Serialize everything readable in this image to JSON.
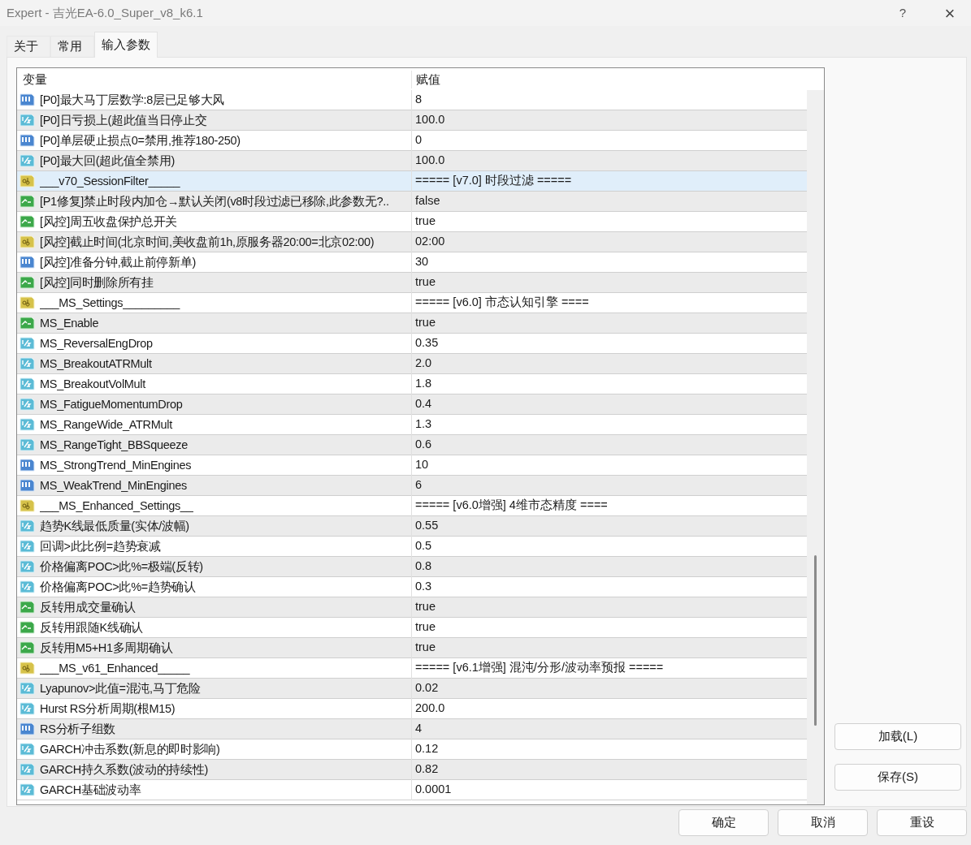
{
  "window": {
    "title": "Expert - 吉光EA-6.0_Super_v8_k6.1",
    "help": "?",
    "close": "×"
  },
  "tabs": [
    {
      "label": "关于",
      "selected": false
    },
    {
      "label": "常用",
      "selected": false
    },
    {
      "label": "输入参数",
      "selected": true
    }
  ],
  "table": {
    "columns": [
      "变量",
      "赋值"
    ],
    "rows": [
      {
        "kind": "int",
        "name": "[P0]最大马丁层数学:8层已足够大风",
        "value": "8",
        "selected": false
      },
      {
        "kind": "double",
        "name": "[P0]日亏损上(超此值当日停止交",
        "value": "100.0",
        "selected": false
      },
      {
        "kind": "int",
        "name": "[P0]单层硬止损点0=禁用,推荐180-250)",
        "value": "0",
        "selected": false
      },
      {
        "kind": "double",
        "name": "[P0]最大回(超此值全禁用)",
        "value": "100.0",
        "selected": false
      },
      {
        "kind": "string",
        "name": "___v70_SessionFilter_____",
        "value": "===== [v7.0] 时段过滤 =====",
        "selected": true
      },
      {
        "kind": "bool",
        "name": "[P1修复]禁止时段内加仓→默认关闭(v8时段过滤已移除,此参数无?..",
        "value": "false",
        "selected": false
      },
      {
        "kind": "bool",
        "name": "[风控]周五收盘保护总开关",
        "value": "true",
        "selected": false
      },
      {
        "kind": "string",
        "name": "[风控]截止时间(北京时间,美收盘前1h,原服务器20:00=北京02:00)",
        "value": "02:00",
        "selected": false
      },
      {
        "kind": "int",
        "name": "[风控]准备分钟,截止前停新单)",
        "value": "30",
        "selected": false
      },
      {
        "kind": "bool",
        "name": "[风控]同时删除所有挂",
        "value": "true",
        "selected": false
      },
      {
        "kind": "string",
        "name": "___MS_Settings_________",
        "value": "===== [v6.0] 市态认知引擎 ====",
        "selected": false
      },
      {
        "kind": "bool",
        "name": "MS_Enable",
        "value": "true",
        "selected": false
      },
      {
        "kind": "double",
        "name": "MS_ReversalEngDrop",
        "value": "0.35",
        "selected": false
      },
      {
        "kind": "double",
        "name": "MS_BreakoutATRMult",
        "value": "2.0",
        "selected": false
      },
      {
        "kind": "double",
        "name": "MS_BreakoutVolMult",
        "value": "1.8",
        "selected": false
      },
      {
        "kind": "double",
        "name": "MS_FatigueMomentumDrop",
        "value": "0.4",
        "selected": false
      },
      {
        "kind": "double",
        "name": "MS_RangeWide_ATRMult",
        "value": "1.3",
        "selected": false
      },
      {
        "kind": "double",
        "name": "MS_RangeTight_BBSqueeze",
        "value": "0.6",
        "selected": false
      },
      {
        "kind": "int",
        "name": "MS_StrongTrend_MinEngines",
        "value": "10",
        "selected": false
      },
      {
        "kind": "int",
        "name": "MS_WeakTrend_MinEngines",
        "value": "6",
        "selected": false
      },
      {
        "kind": "string",
        "name": "___MS_Enhanced_Settings__",
        "value": "===== [v6.0增强] 4维市态精度 ====",
        "selected": false
      },
      {
        "kind": "double",
        "name": "趋势K线最低质量(实体/波幅)",
        "value": "0.55",
        "selected": false
      },
      {
        "kind": "double",
        "name": "回调>此比例=趋势衰减",
        "value": "0.5",
        "selected": false
      },
      {
        "kind": "double",
        "name": "价格偏离POC>此%=极端(反转)",
        "value": "0.8",
        "selected": false
      },
      {
        "kind": "double",
        "name": "价格偏离POC>此%=趋势确认",
        "value": "0.3",
        "selected": false
      },
      {
        "kind": "bool",
        "name": "反转用成交量确认",
        "value": "true",
        "selected": false
      },
      {
        "kind": "bool",
        "name": "反转用跟随K线确认",
        "value": "true",
        "selected": false
      },
      {
        "kind": "bool",
        "name": "反转用M5+H1多周期确认",
        "value": "true",
        "selected": false
      },
      {
        "kind": "string",
        "name": "___MS_v61_Enhanced_____",
        "value": "===== [v6.1增强] 混沌/分形/波动率预报 =====",
        "selected": false
      },
      {
        "kind": "double",
        "name": "Lyapunov>此值=混沌,马丁危险",
        "value": "0.02",
        "selected": false
      },
      {
        "kind": "double",
        "name": "Hurst RS分析周期(根M15)",
        "value": "200.0",
        "selected": false
      },
      {
        "kind": "int",
        "name": "RS分析子组数",
        "value": "4",
        "selected": false
      },
      {
        "kind": "double",
        "name": "GARCH冲击系数(新息的即时影响)",
        "value": "0.12",
        "selected": false
      },
      {
        "kind": "double",
        "name": "GARCH持久系数(波动的持续性)",
        "value": "0.82",
        "selected": false
      },
      {
        "kind": "double",
        "name": "GARCH基础波动率",
        "value": "0.0001",
        "selected": false
      }
    ]
  },
  "side_buttons": [
    "加载(L)",
    "保存(S)"
  ],
  "buttons": [
    "确定",
    "取消",
    "重设"
  ]
}
